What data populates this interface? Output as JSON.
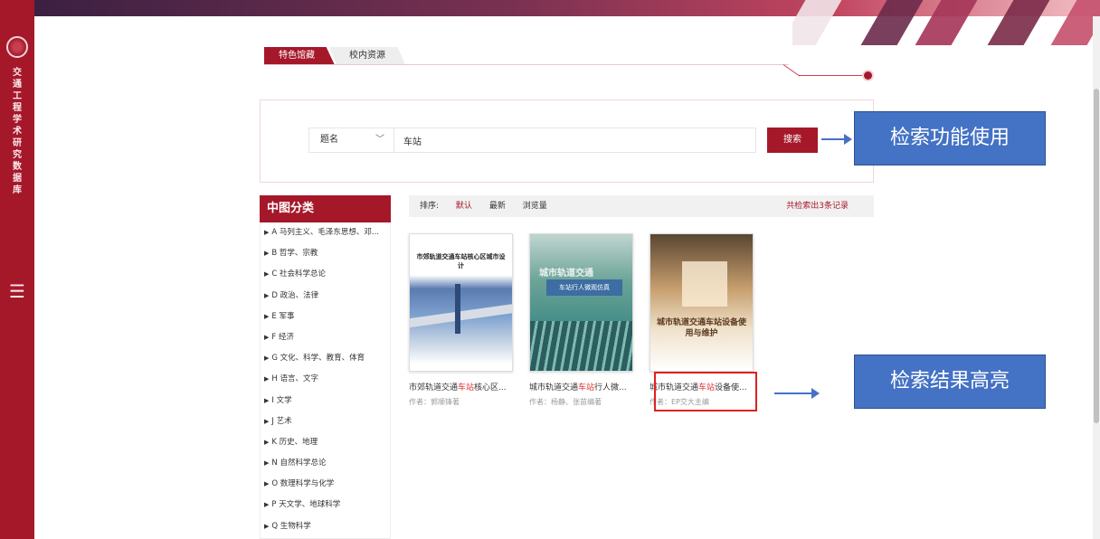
{
  "sidebar": {
    "title": "交通工程学术研究数据库",
    "menu_icon": "hamburger-icon"
  },
  "tabs": [
    {
      "label": "特色馆藏",
      "active": true
    },
    {
      "label": "校内资源",
      "active": false
    }
  ],
  "search": {
    "field": "题名",
    "query": "车站",
    "button": "搜索"
  },
  "callouts": {
    "search": "检索功能使用",
    "highlight": "检索结果高亮"
  },
  "categories": {
    "title": "中图分类",
    "items": [
      "A 马列主义、毛泽东思想、邓...",
      "B 哲学、宗教",
      "C 社会科学总论",
      "D 政治、法律",
      "E 军事",
      "F 经济",
      "G 文化、科学、教育、体育",
      "H 语言、文字",
      "I 文学",
      "J 艺术",
      "K 历史、地理",
      "N 自然科学总论",
      "O 数理科学与化学",
      "P 天文学、地球科学",
      "Q 生物科学"
    ]
  },
  "sort": {
    "label": "排序:",
    "options": [
      "默认",
      "最新",
      "浏览量"
    ],
    "active": "默认",
    "count": "共检索出3条记录"
  },
  "books": [
    {
      "title_pre": "市郊轨道交通",
      "title_hl": "车站",
      "title_post": "核心区...",
      "author": "作者：郭顺锋著",
      "cover_text": "市郊轨道交通车站核心区城市设计"
    },
    {
      "title_pre": "城市轨道交通",
      "title_hl": "车站",
      "title_post": "行人微...",
      "author": "作者：杨静、张苗编著",
      "cover_text": "城市轨道交通",
      "cover_sub": "车站行人微观仿真"
    },
    {
      "title_pre": "城市轨道交通",
      "title_hl": "车站",
      "title_post": "设备使...",
      "author": "作者：EP交大主编",
      "cover_text": "城市轨道交通车站设备使用与维护"
    }
  ]
}
